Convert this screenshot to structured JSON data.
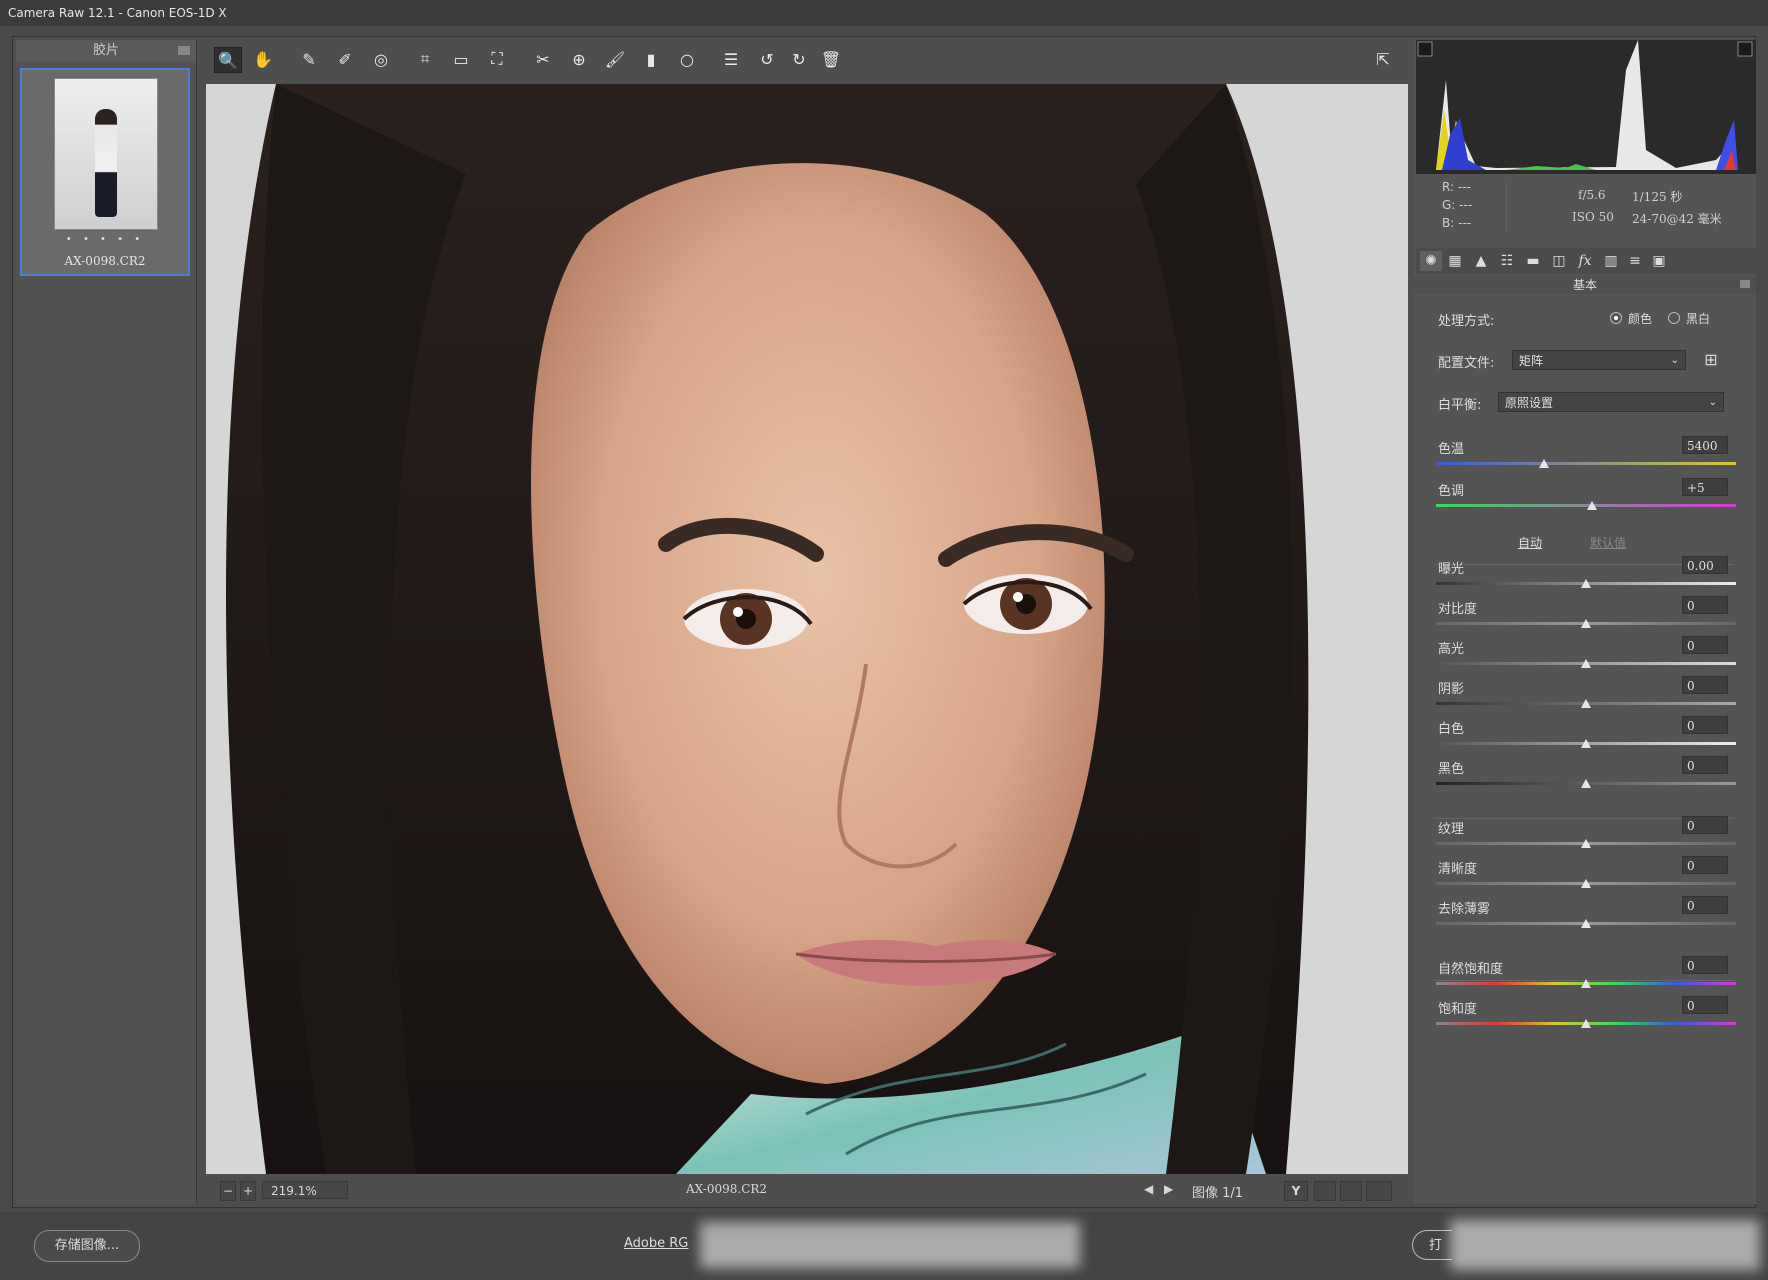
{
  "window": {
    "title": "Camera Raw 12.1 -  Canon EOS-1D X"
  },
  "filmstrip": {
    "header": "胶片",
    "thumbnail": {
      "filename": "AX-0098.CR2",
      "rating_dots": "• • • • •"
    }
  },
  "toolbar": {
    "tools": [
      {
        "name": "zoom-tool-icon",
        "glyph": "🔍"
      },
      {
        "name": "hand-tool-icon",
        "glyph": "✋"
      },
      {
        "name": "white-balance-tool-icon",
        "glyph": "✎"
      },
      {
        "name": "color-sampler-icon",
        "glyph": "✐"
      },
      {
        "name": "targeted-adjustment-icon",
        "glyph": "◎"
      },
      {
        "name": "crop-tool-icon",
        "glyph": "⌗"
      },
      {
        "name": "straighten-tool-icon",
        "glyph": "▭"
      },
      {
        "name": "transform-tool-icon",
        "glyph": "⛶"
      },
      {
        "name": "spot-removal-icon",
        "glyph": "✂"
      },
      {
        "name": "red-eye-icon",
        "glyph": "⊕"
      },
      {
        "name": "adjustment-brush-icon",
        "glyph": "🖌"
      },
      {
        "name": "graduated-filter-icon",
        "glyph": "▮"
      },
      {
        "name": "radial-filter-icon",
        "glyph": "○"
      },
      {
        "name": "presets-list-icon",
        "glyph": "☰"
      },
      {
        "name": "rotate-left-icon",
        "glyph": "↺"
      },
      {
        "name": "rotate-right-icon",
        "glyph": "↻"
      },
      {
        "name": "delete-icon",
        "glyph": "🗑"
      }
    ],
    "fullscreen_glyph": "⇱"
  },
  "statusbar": {
    "zoom_out": "−",
    "zoom_in": "+",
    "zoom": "219.1%",
    "filename": "AX-0098.CR2",
    "image_count": "图像 1/1",
    "prev": "◀",
    "next": "▶",
    "y_compare": "Y"
  },
  "footer": {
    "save_button": "存储图像...",
    "workflow_link": "Adobe RG",
    "open_button": "打"
  },
  "camera_info": {
    "r_label": "R:",
    "r_value": "---",
    "g_label": "G:",
    "g_value": "---",
    "b_label": "B:",
    "b_value": "---",
    "aperture": "f/5.6",
    "shutter": "1/125 秒",
    "iso": "ISO 50",
    "lens": "24-70@42 毫米"
  },
  "panel": {
    "section_title": "基本",
    "treatment_label": "处理方式:",
    "treatment_color": "颜色",
    "treatment_bw": "黑白",
    "profile_label": "配置文件:",
    "profile_value": "矩阵",
    "wb_label": "白平衡:",
    "wb_value": "原照设置",
    "auto": "自动",
    "default": "默认值",
    "sliders": {
      "temp": {
        "label": "色温",
        "value": "5400",
        "pos": 0.36
      },
      "tint": {
        "label": "色调",
        "value": "+5",
        "pos": 0.52
      },
      "exposure": {
        "label": "曝光",
        "value": "0.00",
        "pos": 0.5
      },
      "contrast": {
        "label": "对比度",
        "value": "0",
        "pos": 0.5
      },
      "highlights": {
        "label": "高光",
        "value": "0",
        "pos": 0.5
      },
      "shadows": {
        "label": "阴影",
        "value": "0",
        "pos": 0.5
      },
      "whites": {
        "label": "白色",
        "value": "0",
        "pos": 0.5
      },
      "blacks": {
        "label": "黑色",
        "value": "0",
        "pos": 0.5
      },
      "texture": {
        "label": "纹理",
        "value": "0",
        "pos": 0.5
      },
      "clarity": {
        "label": "清晰度",
        "value": "0",
        "pos": 0.5
      },
      "dehaze": {
        "label": "去除薄雾",
        "value": "0",
        "pos": 0.5
      },
      "vibrance": {
        "label": "自然饱和度",
        "value": "0",
        "pos": 0.5
      },
      "saturation": {
        "label": "饱和度",
        "value": "0",
        "pos": 0.5
      }
    }
  },
  "colors": {
    "accent": "#4c7fd8",
    "background": "#4a4a4a",
    "panel": "#545454"
  }
}
